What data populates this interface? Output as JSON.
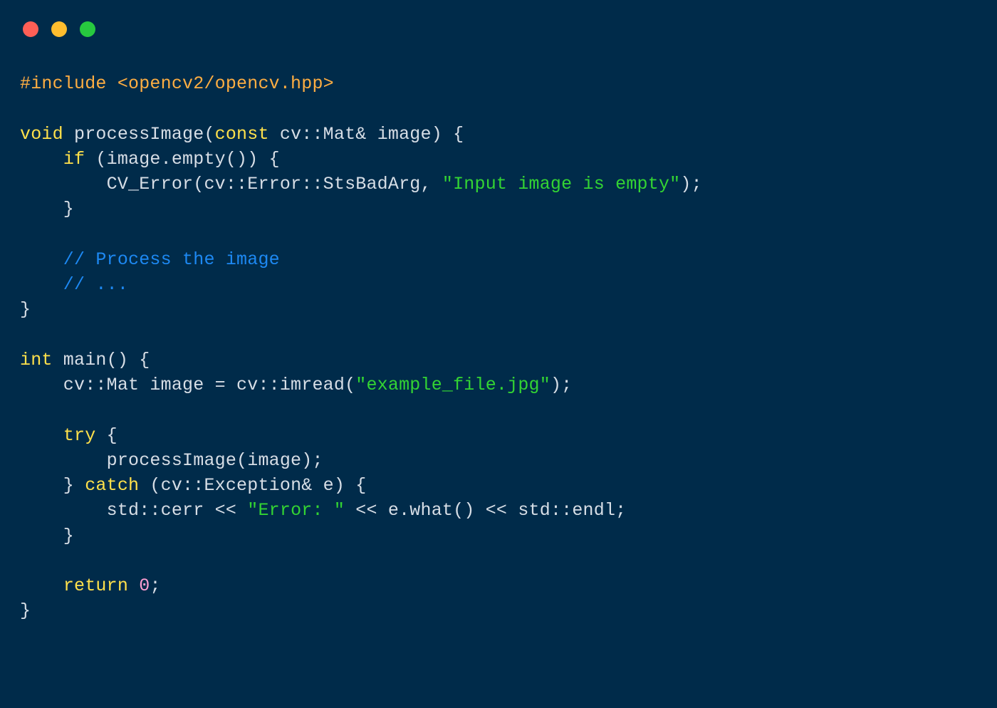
{
  "code": {
    "include": "#include <opencv2/opencv.hpp>",
    "fn_sig_1": "void",
    "fn_sig_2": " processImage(",
    "fn_sig_3": "const",
    "fn_sig_4": " cv::Mat& image) {",
    "if_kw": "if",
    "if_rest": " (image.empty()) {",
    "cv_error_1": "        CV_Error(cv::Error::StsBadArg, ",
    "cv_error_str": "\"Input image is empty\"",
    "cv_error_2": ");",
    "close_if": "    }",
    "comment1": "    // Process the image",
    "comment2": "    // ...",
    "close_fn": "}",
    "main_sig_1": "int",
    "main_sig_2": " main() {",
    "imread_1": "    cv::Mat image = cv::imread(",
    "imread_str": "\"example_file.jpg\"",
    "imread_2": ");",
    "try_kw": "try",
    "try_rest": " {",
    "call_process": "        processImage(image);",
    "close_try": "    } ",
    "catch_kw": "catch",
    "catch_rest": " (cv::Exception& e) {",
    "cerr_1": "        std::cerr << ",
    "cerr_str": "\"Error: \"",
    "cerr_2": " << e.what() << std::endl;",
    "close_catch": "    }",
    "return_kw": "return",
    "return_sp": " ",
    "return_num": "0",
    "return_semi": ";",
    "close_main": "}"
  }
}
